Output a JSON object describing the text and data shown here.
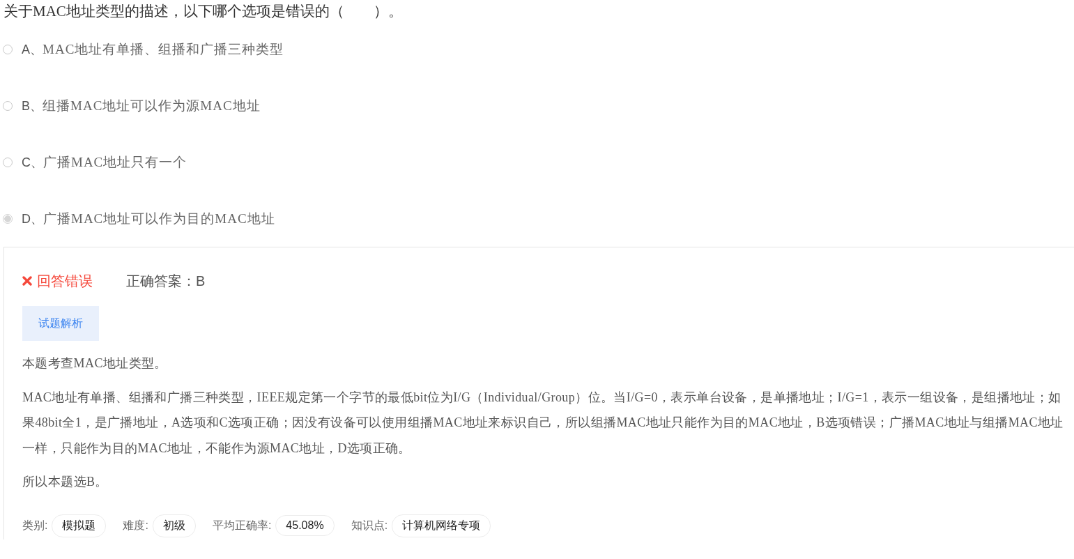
{
  "question": {
    "text": "关于MAC地址类型的描述，以下哪个选项是错误的（　　）。"
  },
  "options": [
    {
      "letter": "A、",
      "text": "MAC地址有单播、组播和广播三种类型",
      "selected": false
    },
    {
      "letter": "B、",
      "text": "组播MAC地址可以作为源MAC地址",
      "selected": false
    },
    {
      "letter": "C、",
      "text": "广播MAC地址只有一个",
      "selected": false
    },
    {
      "letter": "D、",
      "text": "广播MAC地址可以作为目的MAC地址",
      "selected": true
    }
  ],
  "result": {
    "kind": "wrong",
    "status": "回答错误",
    "answer_label": "正确答案：",
    "answer": "B"
  },
  "tab": {
    "label": "试题解析"
  },
  "explanation": [
    "本题考查MAC地址类型。",
    "MAC地址有单播、组播和广播三种类型，IEEE规定第一个字节的最低bit位为I/G（Individual/Group）位。当I/G=0，表示单台设备，是单播地址；I/G=1，表示一组设备，是组播地址；如果48bit全1，是广播地址，A选项和C选项正确；因没有设备可以使用组播MAC地址来标识自己，所以组播MAC地址只能作为目的MAC地址，B选项错误；广播MAC地址与组播MAC地址一样，只能作为目的MAC地址，不能作为源MAC地址，D选项正确。",
    "所以本题选B。"
  ],
  "meta": [
    {
      "label": "类别:",
      "value": "模拟题"
    },
    {
      "label": "难度:",
      "value": "初级"
    },
    {
      "label": "平均正确率:",
      "value": "45.08%"
    },
    {
      "label": "知识点:",
      "value": "计算机网络专项"
    }
  ]
}
